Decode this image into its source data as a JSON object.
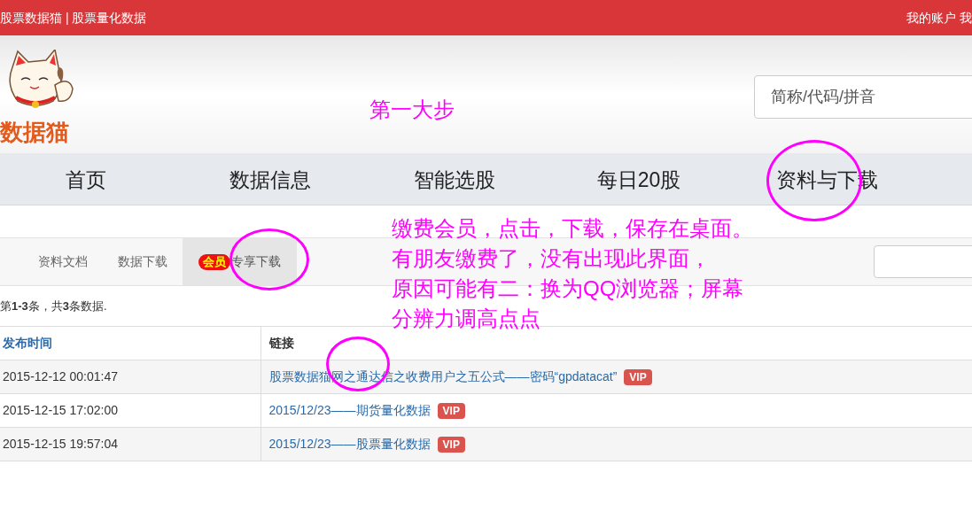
{
  "top_bar": {
    "site_title": "股票数据猫 | 股票量化数据",
    "account": "我的账户 我"
  },
  "header": {
    "logo_text": "数据猫",
    "annotation": "第一大步",
    "search": {
      "placeholder": "简称/代码/拼音"
    }
  },
  "nav": [
    {
      "label": "首页"
    },
    {
      "label": "数据信息"
    },
    {
      "label": "智能选股"
    },
    {
      "label": "每日20股"
    },
    {
      "label": "资料与下载",
      "circled": true
    }
  ],
  "sub_tabs": [
    {
      "label": "资料文档",
      "selected": false
    },
    {
      "label": "数据下载",
      "selected": false
    },
    {
      "badge": "会员",
      "label": "专享下载",
      "selected": true,
      "circled": true
    }
  ],
  "annotation": [
    "缴费会员，点击，下载，保存在桌面。",
    "有朋友缴费了，没有出现此界面，",
    "原因可能有二：换为QQ浏览器；屏幕",
    "分辨力调高点点"
  ],
  "summary": "第**1-3**条，共**3**条数据.",
  "table": {
    "columns": [
      "发布时间",
      "链接"
    ],
    "rows": [
      {
        "time": "2015-12-12 00:01:47",
        "link": "股票数据猫网之通达信之收费用户之五公式——密码“gpdatacat”",
        "badge": "VIP",
        "circled": true
      },
      {
        "time": "2015-12-15 17:02:00",
        "link": "2015/12/23——期货量化数据",
        "badge": "VIP"
      },
      {
        "time": "2015-12-15 19:57:04",
        "link": "2015/12/23——股票量化数据",
        "badge": "VIP"
      }
    ]
  }
}
